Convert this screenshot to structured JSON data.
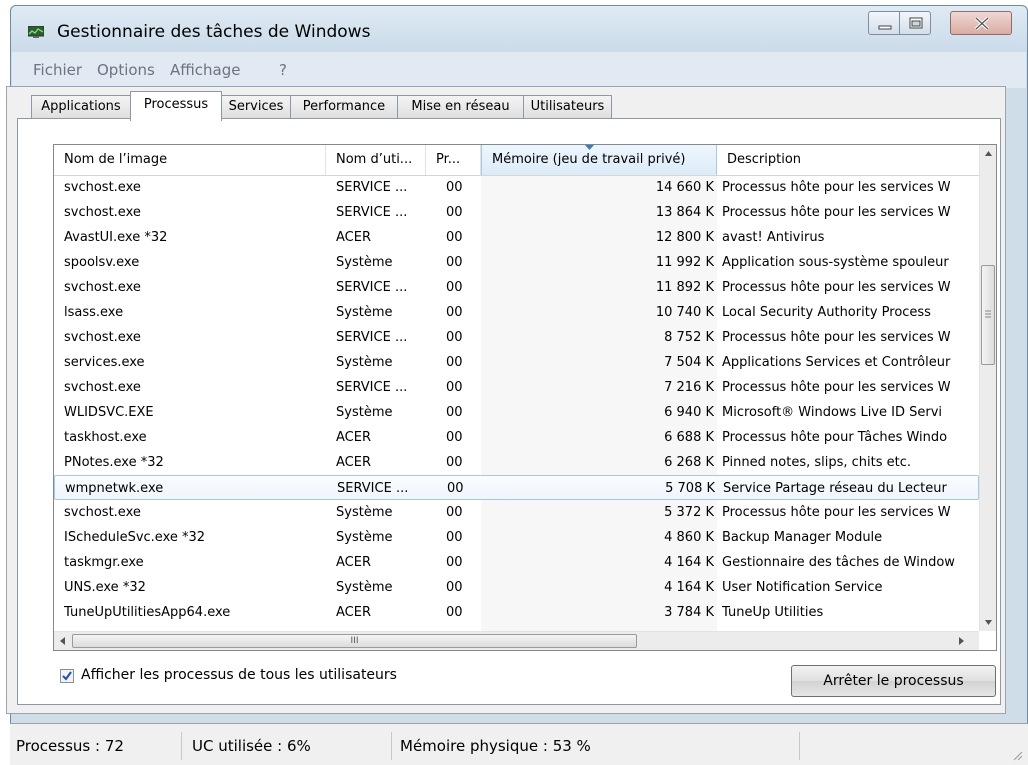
{
  "window": {
    "title": "Gestionnaire des tâches de Windows"
  },
  "menu": [
    "Fichier",
    "Options",
    "Affichage",
    "?"
  ],
  "tabs": [
    "Applications",
    "Processus",
    "Services",
    "Performance",
    "Mise en réseau",
    "Utilisateurs"
  ],
  "active_tab": "Processus",
  "columns": {
    "name": "Nom de l’image",
    "user": "Nom d’uti...",
    "cpu": "Pr...",
    "memory": "Mémoire (jeu de travail privé)",
    "description": "Description"
  },
  "rows": [
    {
      "name": "svchost.exe",
      "user": "SERVICE ...",
      "cpu": "00",
      "mem": "14 660 K",
      "desc": "Processus hôte pour les services W"
    },
    {
      "name": "svchost.exe",
      "user": "SERVICE ...",
      "cpu": "00",
      "mem": "13 864 K",
      "desc": "Processus hôte pour les services W"
    },
    {
      "name": "AvastUI.exe *32",
      "user": "ACER",
      "cpu": "00",
      "mem": "12 800 K",
      "desc": "avast! Antivirus"
    },
    {
      "name": "spoolsv.exe",
      "user": "Système",
      "cpu": "00",
      "mem": "11 992 K",
      "desc": "Application sous-système spouleur"
    },
    {
      "name": "svchost.exe",
      "user": "SERVICE ...",
      "cpu": "00",
      "mem": "11 892 K",
      "desc": "Processus hôte pour les services W"
    },
    {
      "name": "lsass.exe",
      "user": "Système",
      "cpu": "00",
      "mem": "10 740 K",
      "desc": "Local Security Authority Process"
    },
    {
      "name": "svchost.exe",
      "user": "SERVICE ...",
      "cpu": "00",
      "mem": "8 752 K",
      "desc": "Processus hôte pour les services W"
    },
    {
      "name": "services.exe",
      "user": "Système",
      "cpu": "00",
      "mem": "7 504 K",
      "desc": "Applications Services et Contrôleur"
    },
    {
      "name": "svchost.exe",
      "user": "SERVICE ...",
      "cpu": "00",
      "mem": "7 216 K",
      "desc": "Processus hôte pour les services W"
    },
    {
      "name": "WLIDSVC.EXE",
      "user": "Système",
      "cpu": "00",
      "mem": "6 940 K",
      "desc": "Microsoft® Windows Live ID Servi"
    },
    {
      "name": "taskhost.exe",
      "user": "ACER",
      "cpu": "00",
      "mem": "6 688 K",
      "desc": "Processus hôte pour Tâches Windo"
    },
    {
      "name": "PNotes.exe *32",
      "user": "ACER",
      "cpu": "00",
      "mem": "6 268 K",
      "desc": "Pinned notes, slips, chits etc."
    },
    {
      "name": "wmpnetwk.exe",
      "user": "SERVICE ...",
      "cpu": "00",
      "mem": "5 708 K",
      "desc": "Service Partage réseau du Lecteur"
    },
    {
      "name": "svchost.exe",
      "user": "Système",
      "cpu": "00",
      "mem": "5 372 K",
      "desc": "Processus hôte pour les services W"
    },
    {
      "name": "IScheduleSvc.exe *32",
      "user": "Système",
      "cpu": "00",
      "mem": "4 860 K",
      "desc": "Backup Manager Module"
    },
    {
      "name": "taskmgr.exe",
      "user": "ACER",
      "cpu": "00",
      "mem": "4 164 K",
      "desc": "Gestionnaire des tâches de Window"
    },
    {
      "name": "UNS.exe *32",
      "user": "Système",
      "cpu": "00",
      "mem": "4 164 K",
      "desc": "User Notification Service"
    },
    {
      "name": "TuneUpUtilitiesApp64.exe",
      "user": "ACER",
      "cpu": "00",
      "mem": "3 784 K",
      "desc": "TuneUp Utilities"
    }
  ],
  "hover_row": "wmpnetwk.exe",
  "scroll": {
    "h_thumb_grip": "III"
  },
  "show_all_users": {
    "label": "Afficher les processus de tous les utilisateurs",
    "checked": true
  },
  "end_process_button": "Arrêter le processus",
  "status": {
    "processes": "Processus : 72",
    "cpu": "UC utilisée : 6%",
    "memory": "Mémoire physique : 53 %"
  },
  "icons": [
    "taskmgr-app-icon",
    "minimize-icon",
    "maximize-icon",
    "close-icon",
    "sort-desc-icon",
    "scroll-up-icon",
    "scroll-down-icon",
    "scroll-left-icon",
    "scroll-right-icon",
    "checkmark-icon",
    "resize-grip-icon"
  ],
  "colors": {
    "title_bg": "#cfdde9",
    "hover_row_border": "#a5c9e8",
    "sorted_col_bg": "#dcebf8",
    "menu_text": "#6b7480"
  }
}
